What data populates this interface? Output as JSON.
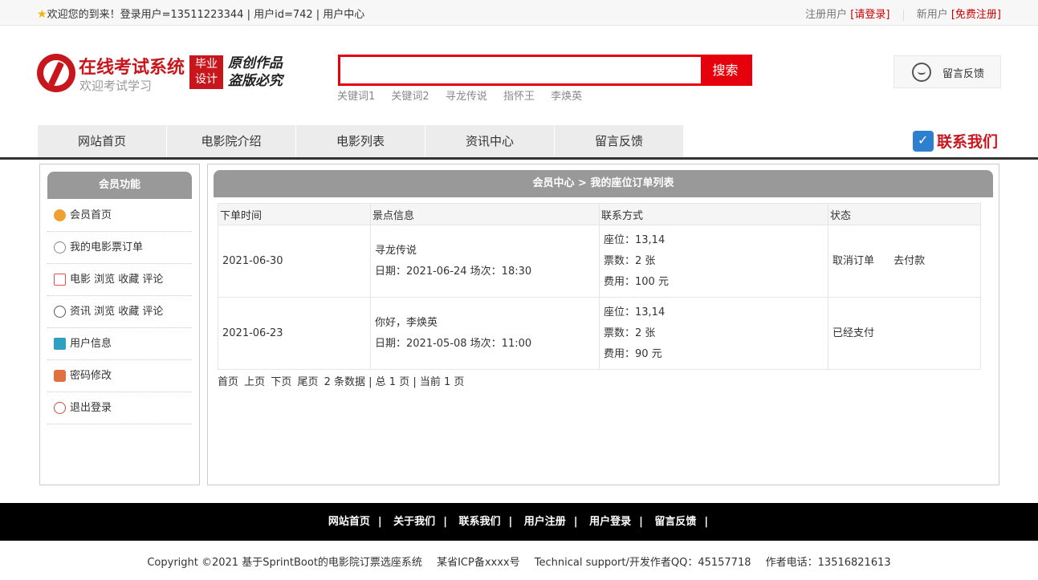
{
  "topbar": {
    "welcome": "欢迎您的到来！登录用户=13511223344 | 用户id=742 | 用户中心",
    "reg_label": "注册用户",
    "login_link": "[请登录]",
    "new_label": "新用户",
    "free_reg_link": "[免费注册]"
  },
  "logo": {
    "title": "在线考试系统",
    "subtitle": "欢迎考试学习",
    "badge_line1": "毕业",
    "badge_line2": "设计",
    "slogan_line1": "原创作品",
    "slogan_line2": "盗版必究"
  },
  "search": {
    "placeholder": "",
    "button": "搜索",
    "keywords": [
      "关键词1",
      "关键词2",
      "寻龙传说",
      "指怀王",
      "李焕英"
    ]
  },
  "feedback_button": "留言反馈",
  "nav": {
    "items": [
      "网站首页",
      "电影院介绍",
      "电影列表",
      "资讯中心",
      "留言反馈"
    ],
    "contact": "联系我们"
  },
  "sidebar": {
    "title": "会员功能",
    "items": [
      {
        "label": "会员首页",
        "icon": "home-icon",
        "color": "#f0a030"
      },
      {
        "label": "我的电影票订单",
        "icon": "heart-icon",
        "color": "#888888"
      },
      {
        "label": "电影 浏览 收藏 评论",
        "icon": "grid-icon",
        "color": "#e05050"
      },
      {
        "label": "资讯 浏览 收藏 评论",
        "icon": "history-icon",
        "color": "#555555"
      },
      {
        "label": "用户信息",
        "icon": "clipboard-icon",
        "color": "#30a0c0"
      },
      {
        "label": "密码修改",
        "icon": "lock-icon",
        "color": "#e07040"
      },
      {
        "label": "退出登录",
        "icon": "power-icon",
        "color": "#c05040"
      }
    ]
  },
  "main": {
    "breadcrumb": "会员中心 > 我的座位订单列表",
    "columns": [
      "下单时间",
      "景点信息",
      "联系方式",
      "状态"
    ],
    "orders": [
      {
        "date": "2021-06-30",
        "movie": "寻龙传说",
        "schedule": "日期：2021-06-24 场次：18:30",
        "seat": "座位：13,14",
        "tickets": "票数：2 张",
        "fee": "费用：100 元",
        "action1": "取消订单",
        "action2": "去付款"
      },
      {
        "date": "2021-06-23",
        "movie": "你好，李焕英",
        "schedule": "日期：2021-05-08 场次：11:00",
        "seat": "座位：13,14",
        "tickets": "票数：2 张",
        "fee": "费用：90 元",
        "status": "已经支付"
      }
    ],
    "pager": {
      "first": "首页",
      "prev": "上页",
      "next": "下页",
      "last": "尾页",
      "summary": "2 条数据 | 总 1 页 | 当前 1 页"
    }
  },
  "footer": {
    "links": [
      "网站首页",
      "关于我们",
      "联系我们",
      "用户注册",
      "用户登录",
      "留言反馈"
    ],
    "copyright": "Copyright ©2021 基于SprintBoot的电影院订票选座系统",
    "icp": "某省ICP备xxxx号",
    "support": "Technical support/开发作者QQ：45157718",
    "phone": "作者电话：13516821613"
  }
}
